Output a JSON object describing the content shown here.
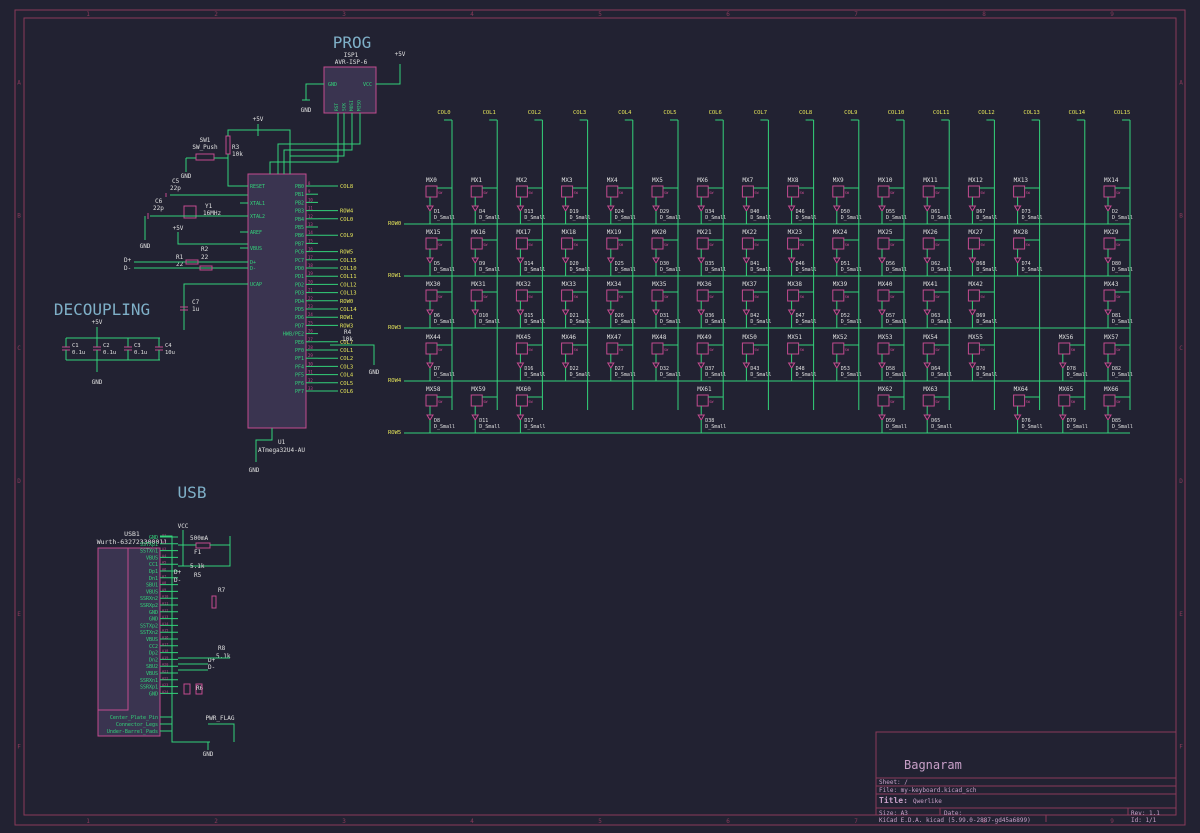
{
  "colors": {
    "background": "#222232",
    "border": "#8a3a5a",
    "wire": "#33d27a",
    "component": "#c34b8f",
    "component_fill": "#3a3450",
    "pin_text": "#33d27a",
    "net_label": "#e6e65a",
    "ref_text": "#e0e0e0",
    "section_title": "#7fb0c8",
    "title_text": "#c8a0c8"
  },
  "sections": {
    "prog": "PROG",
    "decoupling": "DECOUPLING",
    "usb": "USB"
  },
  "border_markers": {
    "top": [
      "1",
      "2",
      "3",
      "4",
      "5",
      "6",
      "7",
      "8",
      "9"
    ],
    "left": [
      "A",
      "B",
      "C",
      "D",
      "E",
      "F"
    ]
  },
  "prog": {
    "isp_ref": "ISP1",
    "isp_value": "AVR-ISP-6",
    "pin_gnd": "GND",
    "pin_vcc": "VCC",
    "pins_bottom": [
      "RST",
      "SCK",
      "MOSI",
      "MISO"
    ],
    "plus5v": "+5V",
    "gnd": "GND"
  },
  "mcu": {
    "ref": "U1",
    "value": "ATmega32U4-AU",
    "left_pins": [
      "RESET",
      "XTAL1",
      "XTAL2",
      "AREF",
      "VBUS",
      "D+",
      "D-",
      "UCAP"
    ],
    "right_pins": [
      "PB0",
      "PB1",
      "PB2",
      "PB3",
      "PB4",
      "PB5",
      "PB6",
      "PB7",
      "PC6",
      "PC7",
      "PD0",
      "PD1",
      "PD2",
      "PD3",
      "PD4",
      "PD5",
      "PD6",
      "PD7",
      "HWB/PE2",
      "PE6",
      "PF0",
      "PF1",
      "PF4",
      "PF5",
      "PF6",
      "PF7"
    ],
    "right_nets": [
      "COL8",
      "",
      "",
      "ROW4",
      "COL0",
      "",
      "COL9",
      "",
      "ROW5",
      "COL15",
      "COL10",
      "COL11",
      "COL12",
      "COL13",
      "ROW0",
      "COL14",
      "ROW1",
      "ROW3",
      "",
      "COL7",
      "COL1",
      "COL2",
      "COL3",
      "COL4",
      "COL5",
      "COL6"
    ],
    "hwb_resistor": "R4",
    "hwb_value": "10k",
    "gnd": "GND",
    "plus5v": "+5V",
    "sw_ref": "SW1",
    "sw_value": "SW_Push",
    "r3_ref": "R3",
    "r3_value": "10k",
    "c5_ref": "C5",
    "c5_value": "22p",
    "c6_ref": "C6",
    "c6_value": "22p",
    "y1_ref": "Y1",
    "y1_value": "16MHz",
    "c7_ref": "C7",
    "c7_value": "1u",
    "r1_ref": "R1",
    "r1_value": "22",
    "r2_ref": "R2",
    "r2_value": "22",
    "dplus": "D+",
    "dminus": "D-"
  },
  "decoupling": {
    "caps": [
      {
        "ref": "C1",
        "value": "0.1u"
      },
      {
        "ref": "C2",
        "value": "0.1u"
      },
      {
        "ref": "C3",
        "value": "0.1u"
      },
      {
        "ref": "C4",
        "value": "10u"
      }
    ],
    "plus5v": "+5V",
    "gnd": "GND"
  },
  "matrix": {
    "columns": [
      "COL0",
      "COL1",
      "COL2",
      "COL3",
      "COL4",
      "COL5",
      "COL6",
      "COL7",
      "COL8",
      "COL9",
      "COL10",
      "COL11",
      "COL12",
      "COL13",
      "COL14",
      "COL15"
    ],
    "rows": [
      "ROW0",
      "ROW1",
      "ROW3",
      "ROW4",
      "ROW5"
    ],
    "diode_value": "D_Small",
    "switch_text": "SW",
    "keys": [
      [
        {
          "c": 0,
          "s": "MX0",
          "d": "D1"
        },
        {
          "c": 1,
          "s": "MX1",
          "d": "D4"
        },
        {
          "c": 2,
          "s": "MX2",
          "d": "D13"
        },
        {
          "c": 3,
          "s": "MX3",
          "d": "D19"
        },
        {
          "c": 4,
          "s": "MX4",
          "d": "D24"
        },
        {
          "c": 5,
          "s": "MX5",
          "d": "D29"
        },
        {
          "c": 6,
          "s": "MX6",
          "d": "D34"
        },
        {
          "c": 7,
          "s": "MX7",
          "d": "D40"
        },
        {
          "c": 8,
          "s": "MX8",
          "d": "D46"
        },
        {
          "c": 9,
          "s": "MX9",
          "d": "D50"
        },
        {
          "c": 10,
          "s": "MX10",
          "d": "D55"
        },
        {
          "c": 11,
          "s": "MX11",
          "d": "D61"
        },
        {
          "c": 12,
          "s": "MX12",
          "d": "D67"
        },
        {
          "c": 13,
          "s": "MX13",
          "d": "D73"
        },
        {
          "c": 15,
          "s": "MX14",
          "d": "D2"
        }
      ],
      [
        {
          "c": 0,
          "s": "MX15",
          "d": "D5"
        },
        {
          "c": 1,
          "s": "MX16",
          "d": "D9"
        },
        {
          "c": 2,
          "s": "MX17",
          "d": "D14"
        },
        {
          "c": 3,
          "s": "MX18",
          "d": "D20"
        },
        {
          "c": 4,
          "s": "MX19",
          "d": "D25"
        },
        {
          "c": 5,
          "s": "MX20",
          "d": "D30"
        },
        {
          "c": 6,
          "s": "MX21",
          "d": "D35"
        },
        {
          "c": 7,
          "s": "MX22",
          "d": "D41"
        },
        {
          "c": 8,
          "s": "MX23",
          "d": "D46"
        },
        {
          "c": 9,
          "s": "MX24",
          "d": "D51"
        },
        {
          "c": 10,
          "s": "MX25",
          "d": "D56"
        },
        {
          "c": 11,
          "s": "MX26",
          "d": "D62"
        },
        {
          "c": 12,
          "s": "MX27",
          "d": "D68"
        },
        {
          "c": 13,
          "s": "MX28",
          "d": "D74"
        },
        {
          "c": 15,
          "s": "MX29",
          "d": "D80"
        }
      ],
      [
        {
          "c": 0,
          "s": "MX30",
          "d": "D6"
        },
        {
          "c": 1,
          "s": "MX31",
          "d": "D10"
        },
        {
          "c": 2,
          "s": "MX32",
          "d": "D15"
        },
        {
          "c": 3,
          "s": "MX33",
          "d": "D21"
        },
        {
          "c": 4,
          "s": "MX34",
          "d": "D26"
        },
        {
          "c": 5,
          "s": "MX35",
          "d": "D31"
        },
        {
          "c": 6,
          "s": "MX36",
          "d": "D36"
        },
        {
          "c": 7,
          "s": "MX37",
          "d": "D42"
        },
        {
          "c": 8,
          "s": "MX38",
          "d": "D47"
        },
        {
          "c": 9,
          "s": "MX39",
          "d": "D52"
        },
        {
          "c": 10,
          "s": "MX40",
          "d": "D57"
        },
        {
          "c": 11,
          "s": "MX41",
          "d": "D63"
        },
        {
          "c": 12,
          "s": "MX42",
          "d": "D69"
        },
        {
          "c": 15,
          "s": "MX43",
          "d": "D81"
        }
      ],
      [
        {
          "c": 0,
          "s": "MX44",
          "d": "D7"
        },
        {
          "c": 2,
          "s": "MX45",
          "d": "D16"
        },
        {
          "c": 3,
          "s": "MX46",
          "d": "D22"
        },
        {
          "c": 4,
          "s": "MX47",
          "d": "D27"
        },
        {
          "c": 5,
          "s": "MX48",
          "d": "D32"
        },
        {
          "c": 6,
          "s": "MX49",
          "d": "D37"
        },
        {
          "c": 7,
          "s": "MX50",
          "d": "D43"
        },
        {
          "c": 8,
          "s": "MX51",
          "d": "D48"
        },
        {
          "c": 9,
          "s": "MX52",
          "d": "D53"
        },
        {
          "c": 10,
          "s": "MX53",
          "d": "D58"
        },
        {
          "c": 11,
          "s": "MX54",
          "d": "D64"
        },
        {
          "c": 12,
          "s": "MX55",
          "d": "D70"
        },
        {
          "c": 14,
          "s": "MX56",
          "d": "D78"
        },
        {
          "c": 15,
          "s": "MX57",
          "d": "D82"
        }
      ],
      [
        {
          "c": 0,
          "s": "MX58",
          "d": "D8"
        },
        {
          "c": 1,
          "s": "MX59",
          "d": "D11"
        },
        {
          "c": 2,
          "s": "MX60",
          "d": "D17"
        },
        {
          "c": 6,
          "s": "MX61",
          "d": "D38"
        },
        {
          "c": 10,
          "s": "MX62",
          "d": "D59"
        },
        {
          "c": 11,
          "s": "MX63",
          "d": "D65"
        },
        {
          "c": 13,
          "s": "MX64",
          "d": "D76"
        },
        {
          "c": 14,
          "s": "MX65",
          "d": "D79"
        },
        {
          "c": 15,
          "s": "MX66",
          "d": "D85"
        }
      ]
    ]
  },
  "usb": {
    "ref": "USB1",
    "value": "Wurth-632723300011",
    "pins": [
      "GND",
      "SSTXp1",
      "SSTXn1",
      "VBUS",
      "CC1",
      "Dp1",
      "Dn1",
      "SBU1",
      "VBUS",
      "SSRXn2",
      "SSRXp2",
      "GND",
      "GND",
      "SSTXp2",
      "SSTXn2",
      "VBUS",
      "CC2",
      "Dp2",
      "Dn2",
      "SBU2",
      "VBUS",
      "SSRXn1",
      "SSRXp1",
      "GND"
    ],
    "footer_pins": [
      "Center_Plate_Pin",
      "Connector_Legs",
      "Under-Barrel_Pads"
    ],
    "vcc": "VCC",
    "fuse_ref": "F1",
    "fuse_value": "500mA",
    "r5_ref": "R5",
    "r5_value": "5.1k",
    "r6_ref": "R6",
    "r7_ref": "R7",
    "r8_ref": "R8",
    "r8_value": "5.1k",
    "d_plus": "D+",
    "d_minus": "D-",
    "pwr_flag": "PWR_FLAG",
    "gnd": "GND"
  },
  "title_block": {
    "company": "Bagnaram",
    "sheet": "Sheet: /",
    "file": "File: my-keyboard.kicad_sch",
    "title_label": "Title:",
    "title_value": "Qwerlike",
    "size": "Size: A3",
    "date": "Date:",
    "rev": "Rev: 1.1",
    "kicad": "KiCad E.D.A.  kicad (5.99.0-2887-gd45a6899)",
    "id": "Id: 1/1"
  }
}
